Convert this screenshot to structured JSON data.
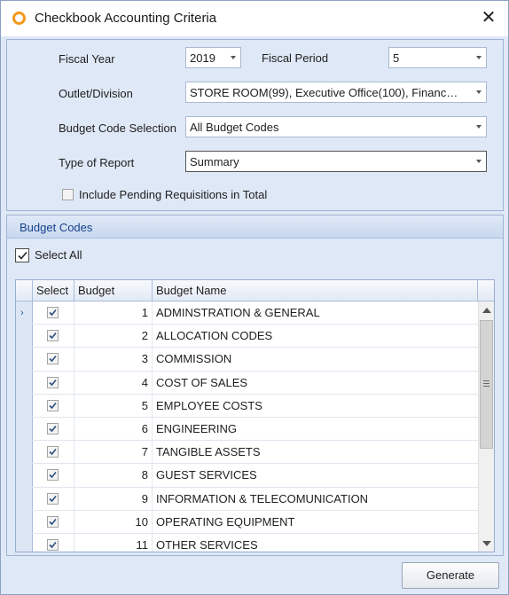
{
  "window": {
    "title": "Checkbook Accounting Criteria",
    "close_glyph": "✕",
    "icon": "circle-logo-icon"
  },
  "criteria": {
    "fiscal_year_label": "Fiscal Year",
    "fiscal_year_value": "2019",
    "fiscal_period_label": "Fiscal Period",
    "fiscal_period_value": "5",
    "outlet_label": "Outlet/Division",
    "outlet_value": "STORE ROOM(99), Executive Office(100), Financ…",
    "budget_code_label": "Budget Code Selection",
    "budget_code_value": "All Budget Codes",
    "report_type_label": "Type of Report",
    "report_type_value": "Summary",
    "include_pending_label": "Include Pending Requisitions in Total",
    "include_pending_checked": false
  },
  "budget_codes": {
    "header": "Budget Codes",
    "select_all_label": "Select All",
    "select_all_checked": true,
    "columns": {
      "select": "Select",
      "budget": "Budget",
      "name": "Budget Name"
    },
    "rows": [
      {
        "budget": "1",
        "name": "ADMINSTRATION & GENERAL",
        "selected": true,
        "current": true
      },
      {
        "budget": "2",
        "name": "ALLOCATION CODES",
        "selected": true
      },
      {
        "budget": "3",
        "name": "COMMISSION",
        "selected": true
      },
      {
        "budget": "4",
        "name": "COST OF SALES",
        "selected": true
      },
      {
        "budget": "5",
        "name": "EMPLOYEE COSTS",
        "selected": true
      },
      {
        "budget": "6",
        "name": "ENGINEERING",
        "selected": true
      },
      {
        "budget": "7",
        "name": "TANGIBLE ASSETS",
        "selected": true
      },
      {
        "budget": "8",
        "name": "GUEST SERVICES",
        "selected": true
      },
      {
        "budget": "9",
        "name": "INFORMATION & TELECOMUNICATION",
        "selected": true
      },
      {
        "budget": "10",
        "name": "OPERATING EQUIPMENT",
        "selected": true
      },
      {
        "budget": "11",
        "name": "OTHER SERVICES",
        "selected": true
      }
    ]
  },
  "footer": {
    "generate_label": "Generate"
  },
  "colors": {
    "accent": "#15428b",
    "panel_bg": "#dfe8f6",
    "icon": "#f39a1e"
  }
}
